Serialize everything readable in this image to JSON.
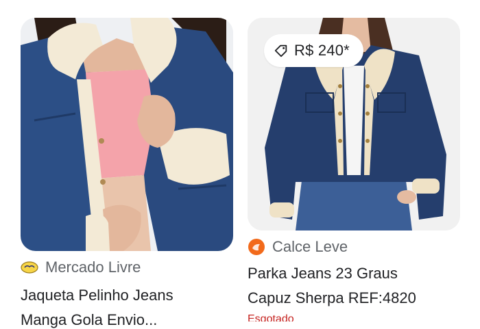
{
  "results": [
    {
      "source": "Mercado Livre",
      "source_logo_icon": "mercado-livre-logo-icon",
      "title_line1": "Jaqueta Pelinho Jeans",
      "title_line2": "Manga Gola Envio..."
    },
    {
      "price": "R$ 240*",
      "price_icon": "price-tag-icon",
      "source": "Calce Leve",
      "source_logo_icon": "calce-leve-logo-icon",
      "title_line1": "Parka Jeans 23 Graus",
      "title_line2": "Capuz Sherpa REF:4820",
      "status": "Esgotado"
    }
  ],
  "colors": {
    "denim": "#2a4a7f",
    "sherpa": "#f3ead6",
    "status_red": "#c5221f",
    "secondary_text": "#5f6368",
    "primary_text": "#202124"
  }
}
